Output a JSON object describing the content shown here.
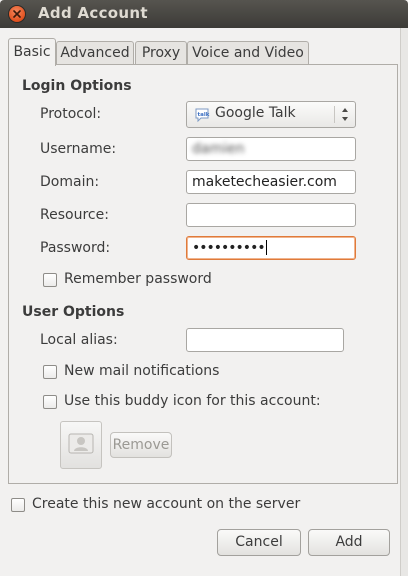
{
  "window": {
    "title": "Add Account"
  },
  "tabs": [
    {
      "label": "Basic",
      "active": true
    },
    {
      "label": "Advanced",
      "active": false
    },
    {
      "label": "Proxy",
      "active": false
    },
    {
      "label": "Voice and Video",
      "active": false
    }
  ],
  "login_options": {
    "heading": "Login Options",
    "protocol_label": "Protocol:",
    "protocol_value": "Google Talk",
    "protocol_icon": "google-talk-icon",
    "username_label": "Username:",
    "username_value": "damien",
    "domain_label": "Domain:",
    "domain_value": "maketecheasier.com",
    "resource_label": "Resource:",
    "resource_value": "",
    "password_label": "Password:",
    "password_value": "••••••••••",
    "remember_password_label": "Remember password",
    "remember_password_checked": false
  },
  "user_options": {
    "heading": "User Options",
    "local_alias_label": "Local alias:",
    "local_alias_value": "",
    "new_mail_label": "New mail notifications",
    "new_mail_checked": false,
    "buddy_icon_label": "Use this buddy icon for this account:",
    "buddy_icon_checked": false,
    "remove_label": "Remove"
  },
  "footer": {
    "create_account_label": "Create this new account on the server",
    "create_account_checked": false,
    "cancel_label": "Cancel",
    "add_label": "Add"
  },
  "colors": {
    "focus_border": "#e07a3a",
    "close_button": "#e0501e",
    "titlebar": "#3c3b37"
  }
}
